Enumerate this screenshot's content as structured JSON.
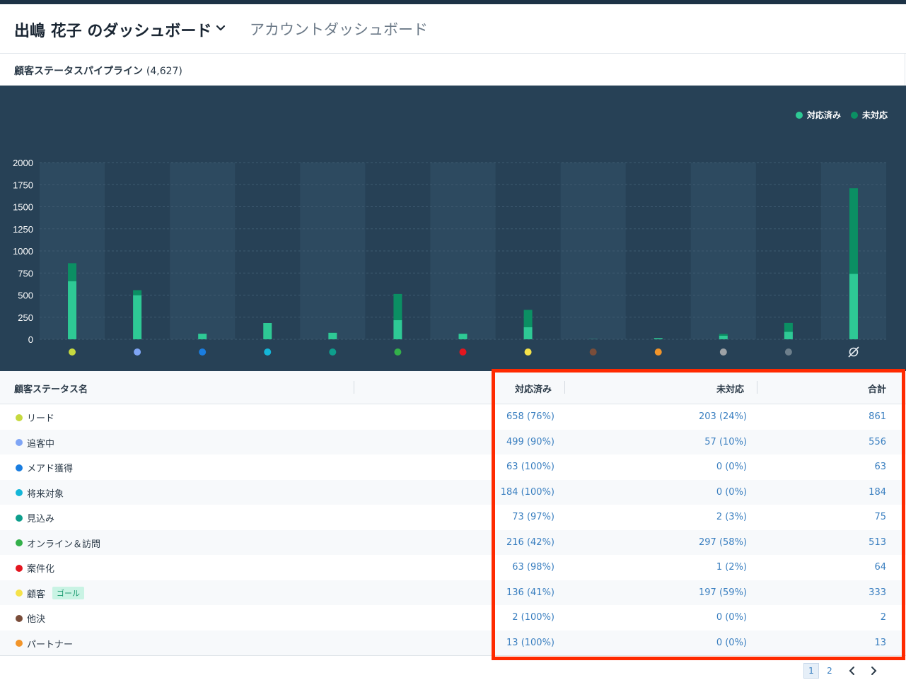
{
  "header": {
    "dashboard_title": "出嶋 花子 のダッシュボード",
    "account_dashboard_label": "アカウントダッシュボード"
  },
  "panel": {
    "title": "顧客ステータスパイプライン",
    "count": "(4,627)"
  },
  "colors": {
    "responded": "#2ec995",
    "unresponded": "#0b8f63",
    "chart_bg": "#274156",
    "highlight": "#ff2a00"
  },
  "chart_data": {
    "type": "bar",
    "stacked": true,
    "ylim": [
      0,
      2000
    ],
    "yticks": [
      "2000",
      "1750",
      "1500",
      "1250",
      "1000",
      "750",
      "500",
      "250",
      "0"
    ],
    "legend": [
      {
        "label": "対応済み",
        "color": "#2ec995"
      },
      {
        "label": "未対応",
        "color": "#0b8f63"
      }
    ],
    "categories": [
      {
        "dot": "#c6d93f"
      },
      {
        "dot": "#7fa5f5"
      },
      {
        "dot": "#1a7de0"
      },
      {
        "dot": "#14b6d8"
      },
      {
        "dot": "#0e9e8c"
      },
      {
        "dot": "#33b04a"
      },
      {
        "dot": "#e3161f"
      },
      {
        "dot": "#f5e24a"
      },
      {
        "dot": "#7a4d3a"
      },
      {
        "dot": "#f2952a"
      },
      {
        "dot": "#9ea2a6"
      },
      {
        "dot": "#6d7f8c"
      },
      {
        "dot": "none",
        "label": "∅"
      }
    ],
    "series": [
      {
        "name": "対応済み",
        "values": [
          658,
          499,
          63,
          184,
          73,
          216,
          63,
          136,
          2,
          13,
          40,
          85,
          740
        ]
      },
      {
        "name": "未対応",
        "values": [
          203,
          57,
          0,
          0,
          2,
          297,
          1,
          197,
          0,
          0,
          20,
          100,
          970
        ]
      }
    ]
  },
  "table": {
    "headers": {
      "name": "顧客ステータス名",
      "responded": "対応済み",
      "unresponded": "未対応",
      "total": "合計"
    },
    "rows": [
      {
        "color": "#c6d93f",
        "name": "リード",
        "responded": "658 (76%)",
        "unresponded": "203 (24%)",
        "total": "861"
      },
      {
        "color": "#7fa5f5",
        "name": "追客中",
        "responded": "499 (90%)",
        "unresponded": "57 (10%)",
        "total": "556"
      },
      {
        "color": "#1a7de0",
        "name": "メアド獲得",
        "responded": "63 (100%)",
        "unresponded": "0 (0%)",
        "total": "63"
      },
      {
        "color": "#14b6d8",
        "name": "将来対象",
        "responded": "184 (100%)",
        "unresponded": "0 (0%)",
        "total": "184"
      },
      {
        "color": "#0e9e8c",
        "name": "見込み",
        "responded": "73 (97%)",
        "unresponded": "2 (3%)",
        "total": "75"
      },
      {
        "color": "#33b04a",
        "name": "オンライン＆訪問",
        "responded": "216 (42%)",
        "unresponded": "297 (58%)",
        "total": "513"
      },
      {
        "color": "#e3161f",
        "name": "案件化",
        "responded": "63 (98%)",
        "unresponded": "1 (2%)",
        "total": "64"
      },
      {
        "color": "#f5e24a",
        "name": "顧客",
        "badge": "ゴール",
        "responded": "136 (41%)",
        "unresponded": "197 (59%)",
        "total": "333"
      },
      {
        "color": "#7a4d3a",
        "name": "他決",
        "responded": "2 (100%)",
        "unresponded": "0 (0%)",
        "total": "2"
      },
      {
        "color": "#f2952a",
        "name": "パートナー",
        "responded": "13 (100%)",
        "unresponded": "0 (0%)",
        "total": "13"
      }
    ]
  },
  "pagination": {
    "pages": [
      "1",
      "2"
    ],
    "current": "1"
  }
}
